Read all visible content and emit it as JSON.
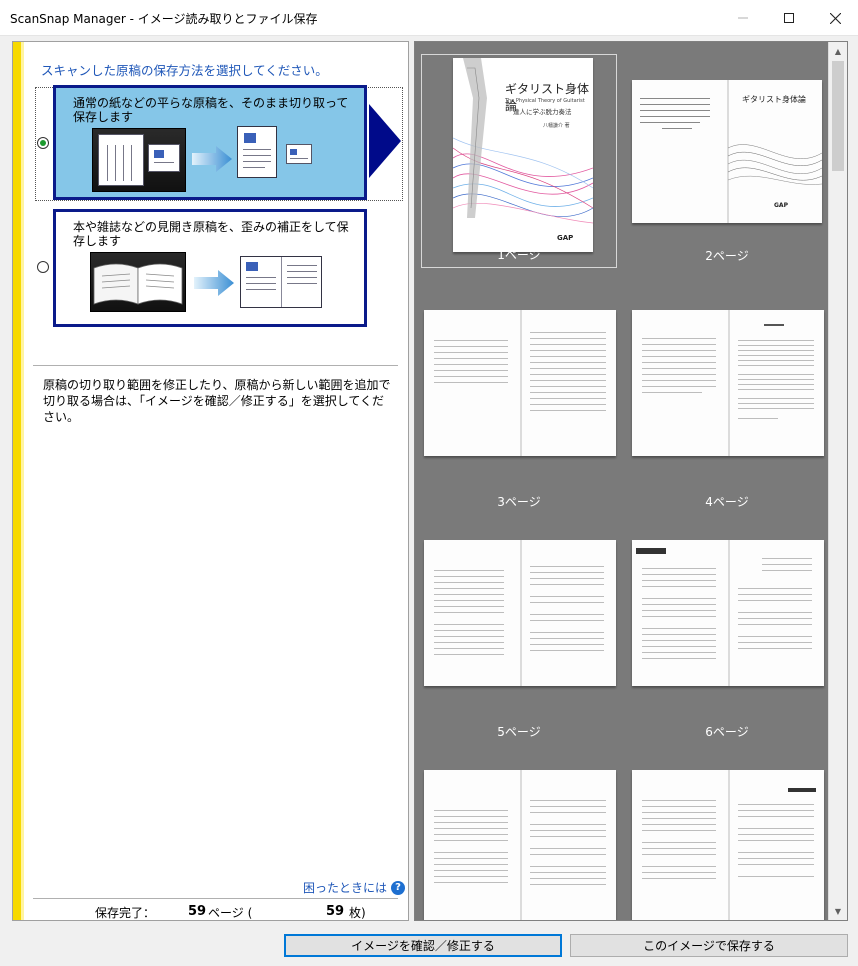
{
  "window": {
    "title": "ScanSnap Manager - イメージ読み取りとファイル保存"
  },
  "left": {
    "heading": "スキャンした原稿の保存方法を選択してください。",
    "options": [
      {
        "label": "通常の紙などの平らな原稿を、そのまま切り取って保存します",
        "selected": true
      },
      {
        "label": "本や雑誌などの見開き原稿を、歪みの補正をして保存します",
        "selected": false
      }
    ],
    "info_text": "原稿の切り取り範囲を修正したり、原稿から新しい範囲を追加で切り取る場合は、「イメージを確認／修正する」を選択してください。",
    "help_link": "困ったときには",
    "status": {
      "label": "保存完了：",
      "pages": "59",
      "pages_unit": "ページ (",
      "sheets": "59",
      "sheets_unit": "枚)"
    }
  },
  "thumbnails": [
    {
      "label": "1ページ",
      "selected": true
    },
    {
      "label": "2ページ",
      "selected": false
    },
    {
      "label": "3ページ",
      "selected": false
    },
    {
      "label": "4ページ",
      "selected": false
    },
    {
      "label": "5ページ",
      "selected": false
    },
    {
      "label": "6ページ",
      "selected": false
    },
    {
      "label": "",
      "selected": false
    },
    {
      "label": "",
      "selected": false
    }
  ],
  "cover": {
    "title": "ギタリスト身体論",
    "subtitle": "The Physical Theory of Guitarist",
    "tagline": "達人に学ぶ脱力奏法",
    "author": "八幡謙介 著",
    "publisher_logo": "GAP"
  },
  "buttons": {
    "confirm": "イメージを確認／修正する",
    "save": "このイメージで保存する"
  },
  "colors": {
    "accent_blue": "#1f57b8",
    "selected_option_bg": "#85c6e8",
    "option_border": "#0a1a8a",
    "stripe_yellow": "#f7d900",
    "thumbnail_bg": "#7a7a7a"
  }
}
